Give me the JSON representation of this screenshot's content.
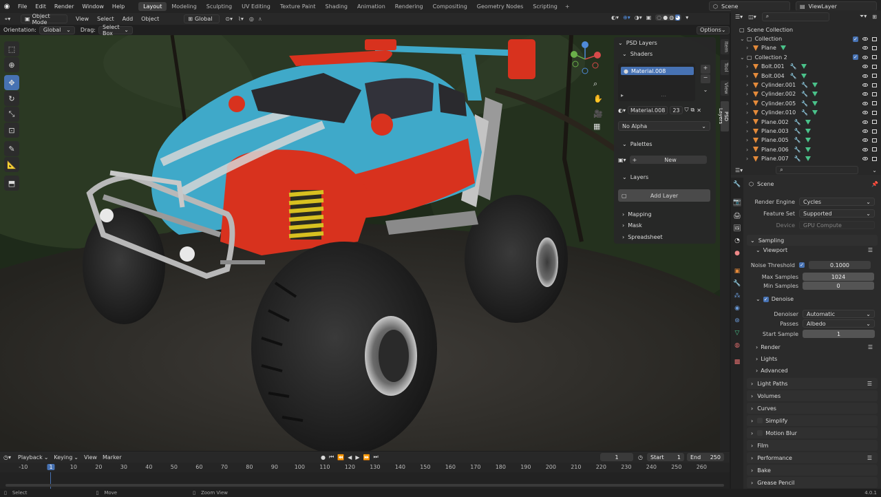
{
  "topbar": {
    "menus": [
      "File",
      "Edit",
      "Render",
      "Window",
      "Help"
    ],
    "workspaces": [
      "Layout",
      "Modeling",
      "Sculpting",
      "UV Editing",
      "Texture Paint",
      "Shading",
      "Animation",
      "Rendering",
      "Compositing",
      "Geometry Nodes",
      "Scripting"
    ],
    "active_workspace": "Layout",
    "add_workspace": "+",
    "scene": "Scene",
    "view_layer": "ViewLayer"
  },
  "viewport_header": {
    "mode": "Object Mode",
    "menus": [
      "View",
      "Select",
      "Add",
      "Object"
    ],
    "transform": "Global",
    "orientation_label": "Orientation:",
    "orientation_value": "Global",
    "drag_label": "Drag:",
    "drag_value": "Select Box",
    "options": "Options"
  },
  "side_tabs": [
    "Item",
    "Tool",
    "View",
    "PSD Layers"
  ],
  "npanel": {
    "title": "PSD Layers",
    "shaders_label": "Shaders",
    "material_item": "Material.008",
    "material_field": "Material.008",
    "material_users": "23",
    "alpha_mode": "No Alpha",
    "palettes_label": "Palettes",
    "palette_new": "New",
    "layers_label": "Layers",
    "add_layer": "Add Layer",
    "mapping_label": "Mapping",
    "mask_label": "Mask",
    "spreadsheet_label": "Spreadsheet"
  },
  "outliner": {
    "root": "Scene Collection",
    "items": [
      {
        "name": "Collection",
        "indent": 1,
        "type": "collection"
      },
      {
        "name": "Plane",
        "indent": 2,
        "type": "object"
      },
      {
        "name": "Collection 2",
        "indent": 1,
        "type": "collection"
      },
      {
        "name": "Bolt.001",
        "indent": 2,
        "type": "object"
      },
      {
        "name": "Bolt.004",
        "indent": 2,
        "type": "object"
      },
      {
        "name": "Cylinder.001",
        "indent": 2,
        "type": "object"
      },
      {
        "name": "Cylinder.002",
        "indent": 2,
        "type": "object"
      },
      {
        "name": "Cylinder.005",
        "indent": 2,
        "type": "object"
      },
      {
        "name": "Cylinder.010",
        "indent": 2,
        "type": "object"
      },
      {
        "name": "Plane.002",
        "indent": 2,
        "type": "object"
      },
      {
        "name": "Plane.003",
        "indent": 2,
        "type": "object"
      },
      {
        "name": "Plane.005",
        "indent": 2,
        "type": "object"
      },
      {
        "name": "Plane.006",
        "indent": 2,
        "type": "object"
      },
      {
        "name": "Plane.007",
        "indent": 2,
        "type": "object"
      }
    ]
  },
  "properties": {
    "context": "Scene",
    "render_engine_label": "Render Engine",
    "render_engine": "Cycles",
    "feature_set_label": "Feature Set",
    "feature_set": "Supported",
    "device_label": "Device",
    "device": "GPU Compute",
    "sampling": "Sampling",
    "viewport": "Viewport",
    "noise_threshold_label": "Noise Threshold",
    "noise_threshold": "0.1000",
    "max_samples_label": "Max Samples",
    "max_samples": "1024",
    "min_samples_label": "Min Samples",
    "min_samples": "0",
    "denoise": "Denoise",
    "denoiser_label": "Denoiser",
    "denoiser": "Automatic",
    "passes_label": "Passes",
    "passes": "Albedo",
    "start_sample_label": "Start Sample",
    "start_sample": "1",
    "sub_render": "Render",
    "sub_lights": "Lights",
    "sub_advanced": "Advanced",
    "sections": [
      "Light Paths",
      "Volumes",
      "Curves",
      "Simplify",
      "Motion Blur",
      "Film",
      "Performance",
      "Bake",
      "Grease Pencil"
    ]
  },
  "timeline": {
    "menus": [
      "Playback",
      "Keying",
      "View",
      "Marker"
    ],
    "current_frame": "1",
    "start_label": "Start",
    "start": "1",
    "end_label": "End",
    "end": "250",
    "ticks": [
      "-10",
      "1",
      "10",
      "20",
      "30",
      "40",
      "50",
      "60",
      "70",
      "80",
      "90",
      "100",
      "110",
      "120",
      "130",
      "140",
      "150",
      "160",
      "170",
      "180",
      "190",
      "200",
      "210",
      "220",
      "230",
      "240",
      "250",
      "260"
    ]
  },
  "statusbar": {
    "select": "Select",
    "move": "Move",
    "zoom": "Zoom View",
    "version": "4.0.1"
  },
  "colors": {
    "accent": "#4772b3",
    "car_blue": "#3fa9c9",
    "car_red": "#d8321e",
    "spring_yellow": "#d8c020",
    "object_orange": "#e48a3a",
    "mesh_green": "#4ac28a"
  }
}
